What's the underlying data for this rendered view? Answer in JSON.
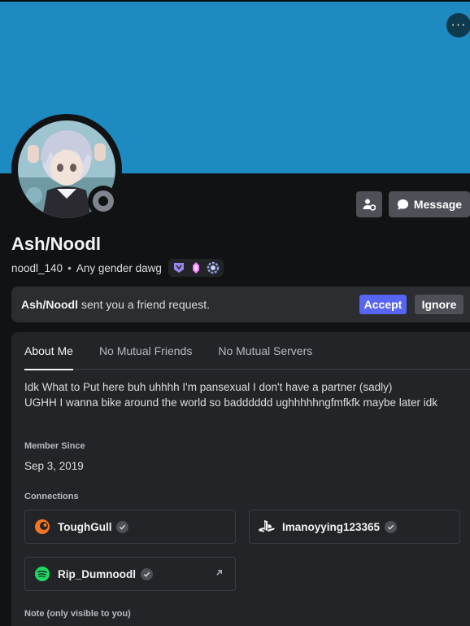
{
  "profile": {
    "display_name": "Ash/Noodl",
    "username": "noodl_140",
    "pronouns": "Any gender dawg",
    "more_label": "···",
    "message_label": "Message"
  },
  "friend_request": {
    "from": "Ash/Noodl",
    "text": "sent you a friend request.",
    "accept_label": "Accept",
    "ignore_label": "Ignore"
  },
  "tabs": [
    {
      "label": "About Me",
      "active": true
    },
    {
      "label": "No Mutual Friends",
      "active": false
    },
    {
      "label": "No Mutual Servers",
      "active": false
    }
  ],
  "about": {
    "bio_line1": "Idk What to Put here buh uhhhh I'm pansexual I don't have a partner (sadly)",
    "bio_line2": "UGHH I wanna bike around the world so badddddd ughhhhhngfmfkfk maybe later idk",
    "member_since_heading": "Member Since",
    "member_since": "Sep 3, 2019",
    "connections_heading": "Connections",
    "note_heading": "Note (only visible to you)"
  },
  "connections": [
    {
      "service": "crunchyroll-icon",
      "name": "ToughGull",
      "verified": true
    },
    {
      "service": "playstation-icon",
      "name": "Imanoyying123365",
      "verified": true
    },
    {
      "service": "spotify-icon",
      "name": "Rip_Dumnoodl",
      "verified": true,
      "external": true
    }
  ],
  "colors": {
    "banner": "#1d8ac2",
    "accent": "#5865f2",
    "background": "#111214",
    "panel": "#232428"
  }
}
